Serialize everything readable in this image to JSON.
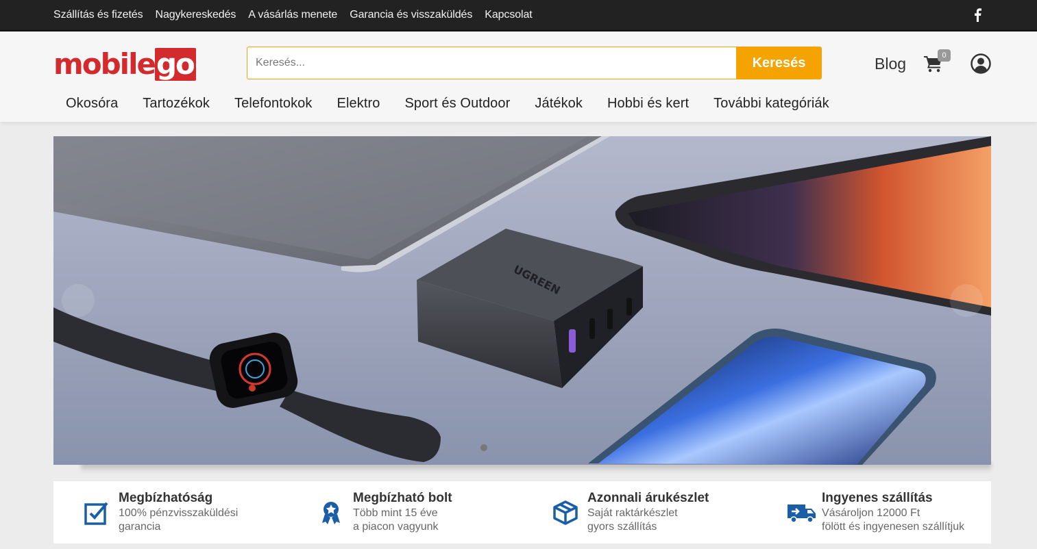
{
  "topbar": {
    "links": [
      "Szállítás és fizetés",
      "Nagykereskedés",
      "A vásárlás menete",
      "Garancia és visszaküldés",
      "Kapcsolat"
    ],
    "social_icon": "facebook-icon"
  },
  "header": {
    "logo": {
      "part1": "mobile",
      "part2": "go"
    },
    "search": {
      "placeholder": "Keresés...",
      "button_label": "Keresés"
    },
    "blog_label": "Blog",
    "cart_count": "0",
    "cart_icon": "cart-icon",
    "user_icon": "user-circle-icon"
  },
  "nav": {
    "items": [
      "Okosóra",
      "Tartozékok",
      "Telefontokok",
      "Elektro",
      "Sport és Outdoor",
      "Játékok",
      "Hobbi és kert",
      "További kategóriák"
    ]
  },
  "hero": {
    "product_text": "UGREEN",
    "prev_icon": "chevron-left-icon",
    "next_icon": "chevron-right-icon"
  },
  "features": [
    {
      "icon": "checkbox-icon",
      "title": "Megbízhatóság",
      "line1": "100% pénzvisszaküldési",
      "line2": "garancia"
    },
    {
      "icon": "award-ribbon-icon",
      "title": "Megbízható bolt",
      "line1": "Több mint 15 éve",
      "line2": "a piacon vagyunk"
    },
    {
      "icon": "box-icon",
      "title": "Azonnali árukészlet",
      "line1": "Saját raktárkészlet",
      "line2": "gyors szállítás"
    },
    {
      "icon": "delivery-truck-icon",
      "title": "Ingyenes szállítás",
      "line1": "Vásároljon 12000 Ft",
      "line2": "fölött és ingyenesen szállítjuk"
    }
  ],
  "colors": {
    "brand_red": "#d32a2e",
    "accent_orange": "#f4a300",
    "icon_blue": "#1a5ea8",
    "topbar": "#222222"
  }
}
